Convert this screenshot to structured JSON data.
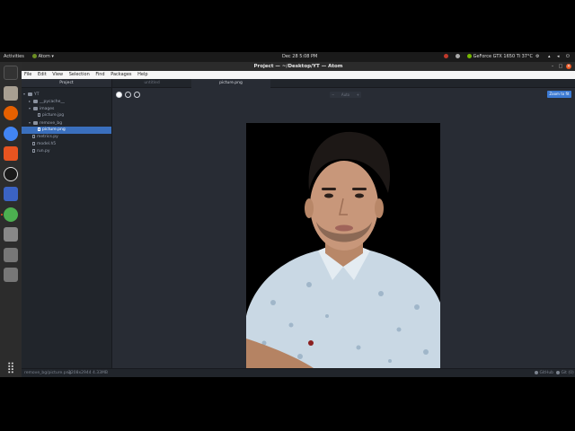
{
  "system": {
    "activities": "Activities",
    "app_menu": "Atom",
    "clock": "Dec 28  5:08 PM",
    "gpu_status": "GeForce GTX 1650 Ti 37°C"
  },
  "window": {
    "title": "Project — ~/Desktop/YT — Atom"
  },
  "menu": [
    "File",
    "Edit",
    "View",
    "Selection",
    "Find",
    "Packages",
    "Help"
  ],
  "tree": {
    "header": "Project",
    "items": [
      {
        "label": "YT",
        "kind": "folder"
      },
      {
        "label": "__pycache__",
        "kind": "folder"
      },
      {
        "label": "images",
        "kind": "folder"
      },
      {
        "label": "picture.jpg",
        "kind": "file"
      },
      {
        "label": "remove_bg",
        "kind": "folder"
      },
      {
        "label": "picture.png",
        "kind": "file"
      },
      {
        "label": "metrics.py",
        "kind": "file"
      },
      {
        "label": "model.h5",
        "kind": "file"
      },
      {
        "label": "run.py",
        "kind": "file"
      }
    ]
  },
  "tabs": [
    "untitled",
    "picture.png"
  ],
  "image_view": {
    "zoom_label": "Auto",
    "zoom_minus": "−",
    "zoom_plus": "+",
    "fit_button": "Zoom to fit"
  },
  "status": {
    "path": "remove_bg/picture.png",
    "info": "2208x2944 4.33MB",
    "github": "GitHub",
    "git": "Git (0)"
  }
}
